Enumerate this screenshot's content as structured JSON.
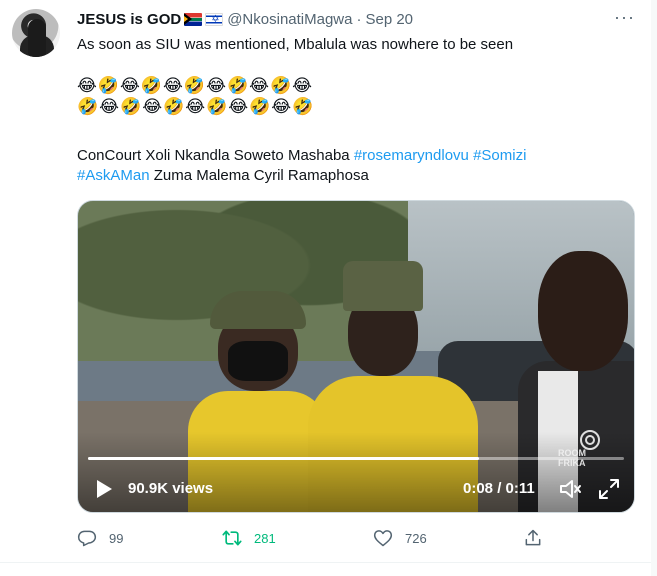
{
  "tweet": {
    "display_name": "JESUS is GOD",
    "handle": "@NkosinatiMagwa",
    "separator": "·",
    "date": "Sep 20",
    "more_label": "···",
    "text_line1": "As soon as SIU was mentioned, Mbalula was nowhere to be seen",
    "emoji_line1": "😂🤣😂🤣😂🤣😂🤣😂🤣😂",
    "emoji_line2": "🤣😂🤣😂🤣😂🤣😂🤣😂🤣",
    "tags_line1_plain": "ConCourt Xoli Nkandla Soweto Mashaba ",
    "tags_line1_hashtags": [
      "#rosemaryndlovu",
      "#Somizi"
    ],
    "tags_line2_hashtag": "#AskAMan",
    "tags_line2_plain": " Zuma Malema Cyril Ramaphosa"
  },
  "video": {
    "views": "90.9K views",
    "timecode": "0:08 / 0:11",
    "progress": 0.73,
    "watermark_line1": "ROOM",
    "watermark_line2": "FRIKA"
  },
  "actions": {
    "reply_count": "99",
    "retweet_count": "281",
    "like_count": "726"
  },
  "colors": {
    "accent": "#1d9bf0",
    "retweet_active": "#00ba7c",
    "muted": "#536471"
  },
  "icons": [
    "avatar",
    "south-africa-flag-icon",
    "israel-flag-icon",
    "more-icon",
    "play-icon",
    "volume-icon",
    "fullscreen-icon",
    "reply-icon",
    "retweet-icon",
    "like-icon",
    "share-icon"
  ]
}
